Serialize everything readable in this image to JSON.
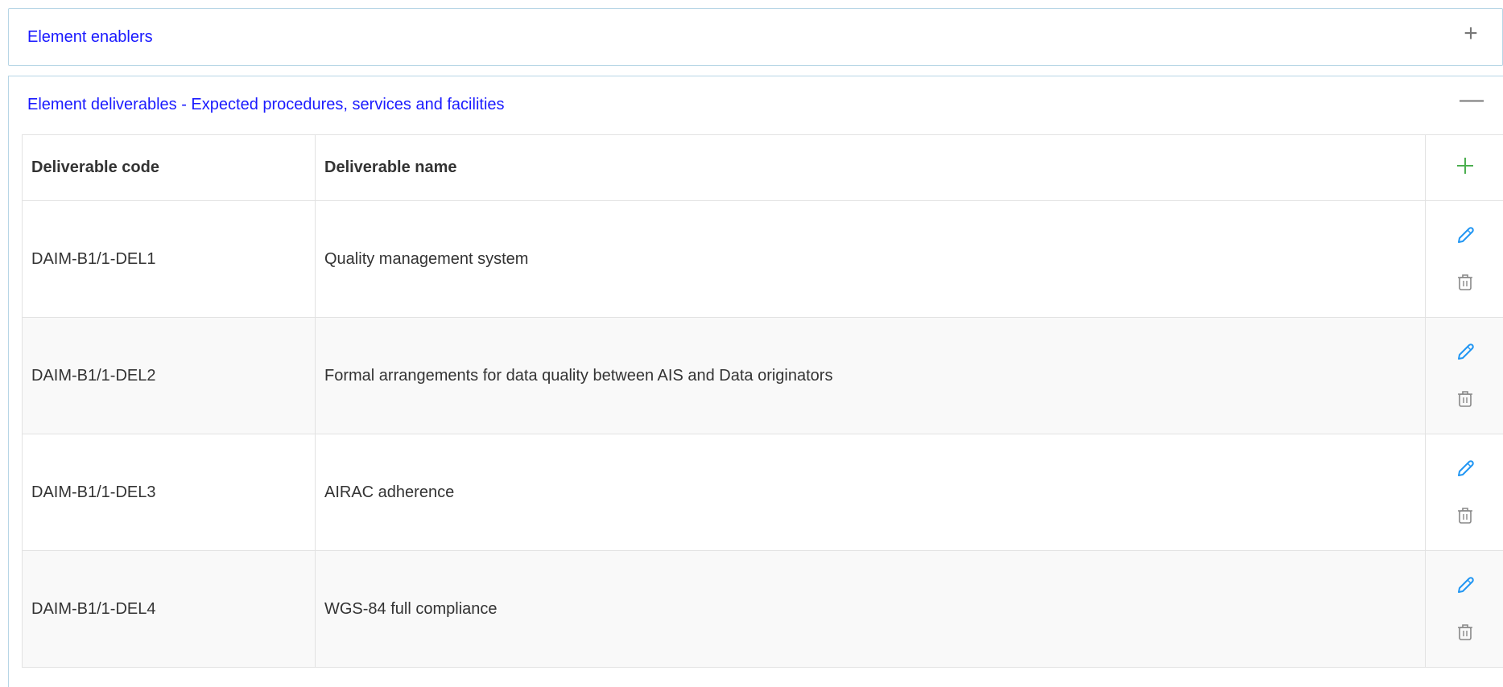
{
  "enablers": {
    "title": "Element enablers",
    "toggle": "+"
  },
  "deliverables": {
    "title": "Element deliverables - Expected procedures, services and facilities",
    "toggle": "—",
    "columns": {
      "code": "Deliverable code",
      "name": "Deliverable name"
    },
    "rows": [
      {
        "code": "DAIM-B1/1-DEL1",
        "name": "Quality management system"
      },
      {
        "code": "DAIM-B1/1-DEL2",
        "name": "Formal arrangements for data quality between AIS and Data originators"
      },
      {
        "code": "DAIM-B1/1-DEL3",
        "name": "AIRAC adherence"
      },
      {
        "code": "DAIM-B1/1-DEL4",
        "name": "WGS-84 full compliance"
      }
    ]
  },
  "icons": {
    "add": "plus-icon",
    "edit": "pencil-icon",
    "delete": "trash-icon"
  },
  "colors": {
    "title_link": "#1a1aff",
    "add_icon": "#4caf50",
    "edit_icon": "#2196f3",
    "delete_icon": "#888888",
    "border": "#b7d6e6"
  }
}
